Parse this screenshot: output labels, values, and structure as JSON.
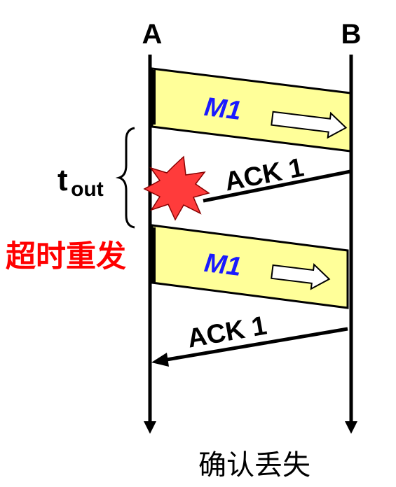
{
  "participants": {
    "a": "A",
    "b": "B"
  },
  "messages": {
    "m1_first": "M1",
    "ack1_lost": "ACK 1",
    "m1_retransmit": "M1",
    "ack1_received": "ACK 1"
  },
  "timeout": {
    "base": "t",
    "subscript": "out"
  },
  "retransmit_label": "超时重发",
  "caption": "确认丢失",
  "colors": {
    "message_fill": "#ffff99",
    "message_text": "#1a1aff",
    "retransmit_text": "#ff0000",
    "explosion": "#ff3b3b"
  }
}
